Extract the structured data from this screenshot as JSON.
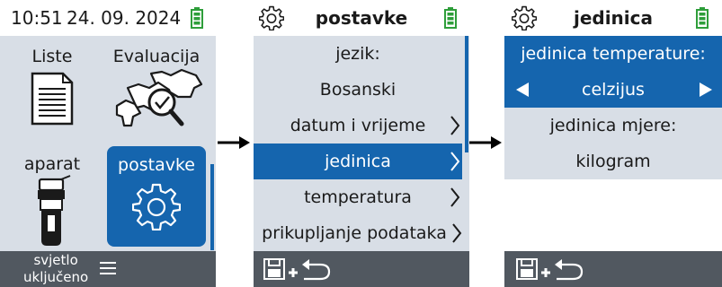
{
  "colors": {
    "accent": "#1565ae",
    "background": "#d8dee6",
    "bottombar": "#515860",
    "battery": "#2e9e3a"
  },
  "screen1": {
    "time": "10:51",
    "date": "24. 09. 2024",
    "tiles": [
      {
        "label": "Liste",
        "icon": "list-document-icon"
      },
      {
        "label": "Evaluacija",
        "icon": "cows-magnifier-icon"
      },
      {
        "label": "aparat",
        "icon": "handheld-device-icon"
      },
      {
        "label": "postavke",
        "icon": "gear-icon"
      }
    ],
    "bottom_label": "svjetlo uključeno",
    "bottom_line1": "svjetlo",
    "bottom_line2": "uključeno",
    "menu_icon": "hamburger-menu-icon"
  },
  "screen2": {
    "title": "postavke",
    "items": [
      {
        "label": "jezik:"
      },
      {
        "label": "Bosanski"
      },
      {
        "label": "datum i vrijeme"
      },
      {
        "label": "jedinica",
        "selected": true
      },
      {
        "label": "temperatura"
      },
      {
        "label": "prikupljanje podataka"
      }
    ],
    "bottom_icon": "save-and-return-icon"
  },
  "screen3": {
    "title": "jedinica",
    "items": [
      {
        "label": "jedinica temperature:"
      },
      {
        "label": "celzijus",
        "selected": true
      },
      {
        "label": "jedinica mjere:"
      },
      {
        "label": "kilogram"
      }
    ],
    "bottom_icon": "save-and-return-icon"
  }
}
